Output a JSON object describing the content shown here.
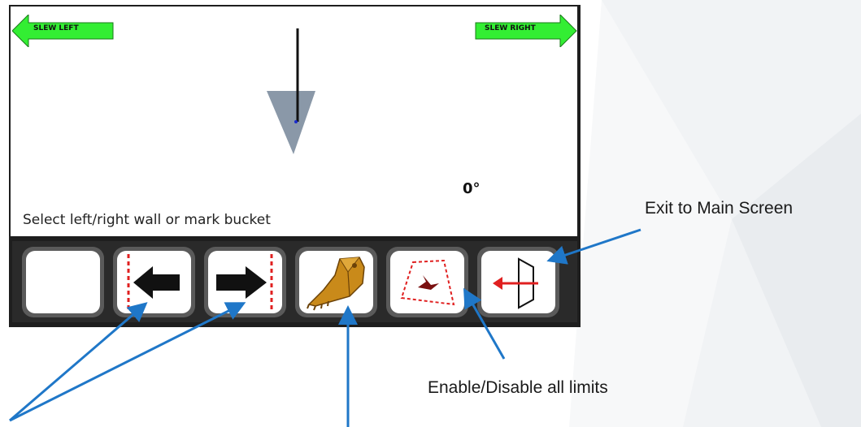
{
  "display": {
    "slew_left_label": "SLEW LEFT",
    "slew_right_label": "SLEW RIGHT",
    "prompt": "Select left/right wall or mark bucket",
    "angle": "0°"
  },
  "toolbar": {
    "buttons": [
      {
        "name": "blank",
        "icon": "blank"
      },
      {
        "name": "left-wall",
        "icon": "arrow-left-with-dashed-wall-icon"
      },
      {
        "name": "right-wall",
        "icon": "arrow-right-with-dashed-wall-icon"
      },
      {
        "name": "mark-bucket",
        "icon": "excavator-bucket-icon"
      },
      {
        "name": "limits-toggle",
        "icon": "dashed-limit-zone-icon"
      },
      {
        "name": "exit",
        "icon": "exit-door-icon"
      }
    ]
  },
  "annotations": {
    "exit": "Exit to Main Screen",
    "limits": "Enable/Disable all limits"
  },
  "colors": {
    "slew_green": "#33ee33",
    "indicator_gray": "#8a98a8",
    "callout_blue": "#1f77c8",
    "limit_red": "#e02020"
  }
}
